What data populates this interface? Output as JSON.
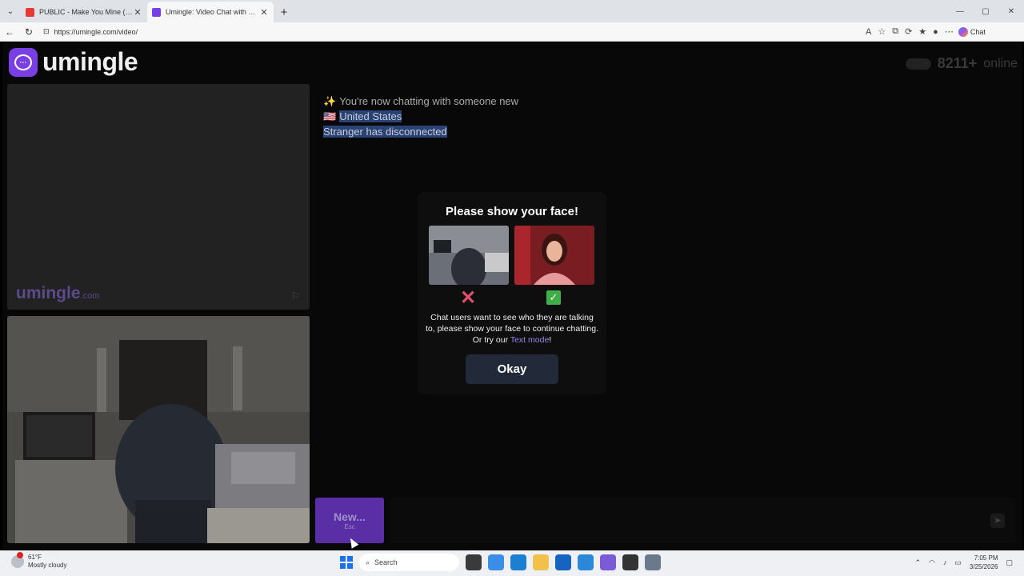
{
  "browser": {
    "tabs": [
      {
        "title": "PUBLIC - Make You Mine (Put Your",
        "active": false,
        "favicon_color": "#e53935"
      },
      {
        "title": "Umingle: Video Chat with Stra",
        "active": true,
        "favicon_color": "#7a3fe4"
      }
    ],
    "url": "https://umingle.com/video/",
    "copilot_label": "Chat"
  },
  "site": {
    "logo_text": "umingle",
    "online_count": "8211+",
    "online_label": "online",
    "watermark": "umingle",
    "watermark_suffix": ".com"
  },
  "chat": {
    "messages": [
      {
        "icon": "✨",
        "text": "You're now chatting with someone new",
        "selected": false
      },
      {
        "icon": "🇺🇸",
        "text": "United States",
        "selected": true
      },
      {
        "icon": "",
        "text": "Stranger has disconnected",
        "selected": true
      }
    ]
  },
  "modal": {
    "title": "Please show your face!",
    "body_before": "Chat users want to see who they are talking to, please show your face to continue chatting. Or try our ",
    "body_link": "Text mode",
    "body_after": "!",
    "ok_label": "Okay"
  },
  "controls": {
    "new_label": "New...",
    "new_hint": "Esc"
  },
  "taskbar": {
    "temp": "61°F",
    "weather": "Mostly cloudy",
    "search_placeholder": "Search",
    "time": "7:05 PM",
    "date": "3/25/2026"
  }
}
